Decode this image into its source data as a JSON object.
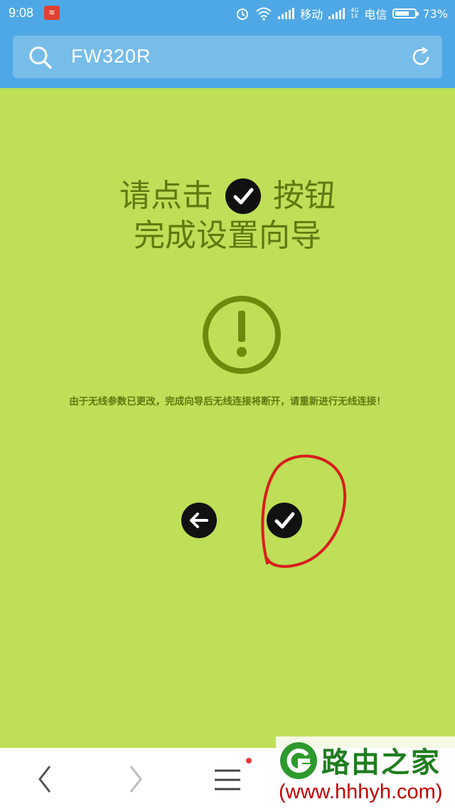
{
  "status_bar": {
    "time": "9:08",
    "carrier1": "移动",
    "net_label": "4G\n1X",
    "carrier2": "电信",
    "battery_pct": "73%",
    "battery_level": 0.73
  },
  "search": {
    "query": "FW320R"
  },
  "content": {
    "title_line1_before": "请点击",
    "title_line1_after": "按钮",
    "title_line2": "完成设置向导",
    "notice": "由于无线参数已更改，完成向导后无线连接将断开，请重新进行无线连接！"
  },
  "watermark": {
    "title": "路由之家",
    "url": "(www.hhhyh.com)"
  },
  "colors": {
    "background": "#bedf57",
    "header": "#4fa8e6",
    "text_olive": "#5f7a10",
    "annotation_red": "#d81e1e"
  },
  "icons": {
    "search": "search-icon",
    "refresh": "refresh-icon",
    "warning": "exclamation-circle-icon",
    "back": "arrow-left-icon",
    "confirm": "check-icon"
  }
}
